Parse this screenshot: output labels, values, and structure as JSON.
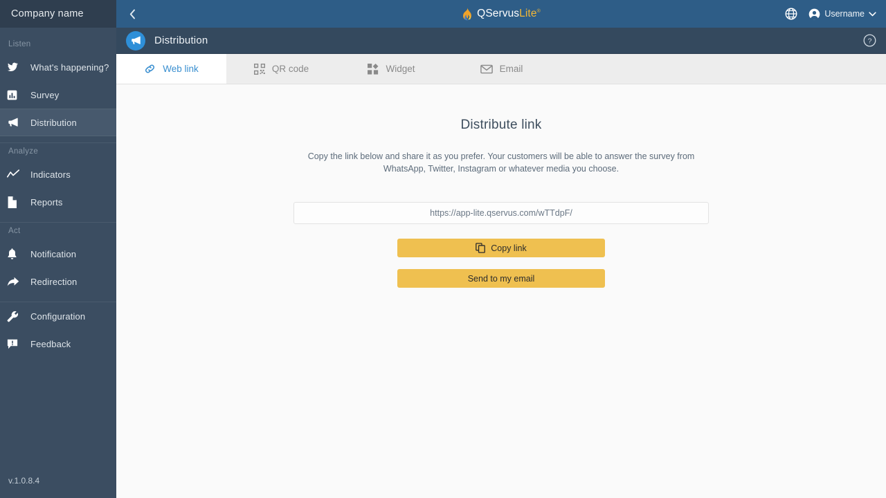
{
  "sidebar": {
    "company_name": "Company name",
    "version": "v.1.0.8.4",
    "groups": [
      {
        "label": "Listen",
        "items": [
          {
            "label": "What's happening?",
            "icon": "bird-icon",
            "active": false
          },
          {
            "label": "Survey",
            "icon": "bar-chart-icon",
            "active": false
          },
          {
            "label": "Distribution",
            "icon": "megaphone-icon",
            "active": true
          }
        ]
      },
      {
        "label": "Analyze",
        "items": [
          {
            "label": "Indicators",
            "icon": "line-chart-icon",
            "active": false
          },
          {
            "label": "Reports",
            "icon": "document-icon",
            "active": false
          }
        ]
      },
      {
        "label": "Act",
        "items": [
          {
            "label": "Notification",
            "icon": "bell-icon",
            "active": false
          },
          {
            "label": "Redirection",
            "icon": "share-arrow-icon",
            "active": false
          },
          {
            "label": "Configuration",
            "icon": "wrench-icon",
            "active": false
          },
          {
            "label": "Feedback",
            "icon": "feedback-bubble-icon",
            "active": false
          }
        ]
      }
    ]
  },
  "topbar": {
    "back_label": "‹",
    "brand_primary": "QServus",
    "brand_secondary": "Lite",
    "brand_trademark": "®",
    "username": "Username",
    "chevron": "⌄"
  },
  "titlebar": {
    "title": "Distribution",
    "icon": "megaphone-icon",
    "help_icon": "question-circle-icon"
  },
  "tabs": [
    {
      "label": "Web link",
      "icon": "link-icon",
      "active": true
    },
    {
      "label": "QR code",
      "icon": "qr-code-icon",
      "active": false
    },
    {
      "label": "Widget",
      "icon": "widget-icon",
      "active": false
    },
    {
      "label": "Email",
      "icon": "envelope-icon",
      "active": false
    }
  ],
  "content": {
    "heading": "Distribute link",
    "description": "Copy the link below and share it as you prefer. Your customers will be able to answer the survey from WhatsApp, Twitter, Instagram or whatever media you choose.",
    "link_value": "https://app-lite.qservus.com/wTTdpF/",
    "copy_button_label": "Copy link",
    "send_email_button_label": "Send to my email"
  },
  "colors": {
    "sidebar_bg": "#3b4d61",
    "sidebar_header_bg": "#2f3e4f",
    "sidebar_active_bg": "#47596d",
    "topbar_bg": "#2e5d87",
    "titlebar_bg": "#34495e",
    "accent_blue": "#3a8fd0",
    "button_gold": "#efc050",
    "content_bg": "#fafafa",
    "brand_lite": "#f2b736"
  }
}
